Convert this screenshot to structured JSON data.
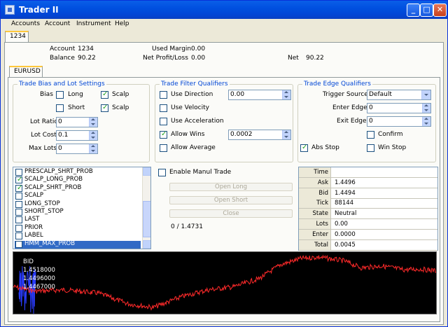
{
  "window": {
    "title": "Trader II"
  },
  "menu": [
    "Accounts",
    "Account",
    "Instrument",
    "Help"
  ],
  "tabs": {
    "account_tab": "1234",
    "instrument_tab": "EURUSD"
  },
  "summary": {
    "account_label": "Account",
    "account_value": "1234",
    "balance_label": "Balance",
    "balance_value": "90.22",
    "used_margin_label": "Used Margin",
    "used_margin_value": "0.00",
    "net_pl_label": "Net Profit/Loss",
    "net_pl_value": "0.00",
    "net_label": "Net",
    "net_value": "90.22"
  },
  "bias_group": {
    "title": "Trade Bias and Lot Settings",
    "bias_label": "Bias",
    "long_label": "Long",
    "long_checked": false,
    "short_label": "Short",
    "short_checked": false,
    "scalp1_label": "Scalp",
    "scalp1_checked": true,
    "scalp2_label": "Scalp",
    "scalp2_checked": true,
    "lot_ratio_label": "Lot Ratio",
    "lot_ratio_value": "0",
    "lot_cost_label": "Lot Cost",
    "lot_cost_value": "0.1",
    "max_lots_label": "Max Lots",
    "max_lots_value": "0"
  },
  "filter_group": {
    "title": "Trade Filter Qualifiers",
    "use_direction_label": "Use Direction",
    "use_direction_checked": false,
    "use_direction_value": "0.00",
    "use_velocity_label": "Use Velocity",
    "use_velocity_checked": false,
    "use_acceleration_label": "Use Acceleration",
    "use_acceleration_checked": false,
    "allow_wins_label": "Allow Wins",
    "allow_wins_checked": true,
    "allow_wins_value": "0.0002",
    "allow_average_label": "Allow Average",
    "allow_average_checked": false
  },
  "edge_group": {
    "title": "Trade Edge Qualifiers",
    "trigger_source_label": "Trigger Source",
    "trigger_source_value": "Default",
    "enter_edge_label": "Enter Edge",
    "enter_edge_value": "0",
    "exit_edge_label": "Exit Edge",
    "exit_edge_value": "0",
    "confirm_label": "Confirm",
    "confirm_checked": false,
    "abs_stop_label": "Abs Stop",
    "abs_stop_checked": true,
    "win_stop_label": "Win Stop",
    "win_stop_checked": false
  },
  "signal_list": [
    {
      "label": "PRESCALP_SHRT_PROB",
      "checked": false,
      "selected": false
    },
    {
      "label": "SCALP_LONG_PROB",
      "checked": true,
      "selected": false
    },
    {
      "label": "SCALP_SHRT_PROB",
      "checked": true,
      "selected": false
    },
    {
      "label": "SCALP",
      "checked": false,
      "selected": false
    },
    {
      "label": "LONG_STOP",
      "checked": false,
      "selected": false
    },
    {
      "label": "SHORT_STOP",
      "checked": false,
      "selected": false
    },
    {
      "label": "LAST",
      "checked": false,
      "selected": false
    },
    {
      "label": "PRIOR",
      "checked": false,
      "selected": false
    },
    {
      "label": "LABEL",
      "checked": false,
      "selected": false
    },
    {
      "label": "HMM_MAX_PROB",
      "checked": false,
      "selected": true
    }
  ],
  "manual": {
    "enable_label": "Enable Manul Trade",
    "enable_checked": false,
    "open_long_label": "Open Long",
    "open_short_label": "Open Short",
    "close_label": "Close",
    "status_text": "0 / 1.4731"
  },
  "quote_grid": [
    {
      "key": "Time",
      "value": ""
    },
    {
      "key": "Ask",
      "value": "1.4496"
    },
    {
      "key": "Bid",
      "value": "1.4494"
    },
    {
      "key": "Tick",
      "value": "88144"
    },
    {
      "key": "State",
      "value": "Neutral"
    },
    {
      "key": "Lots",
      "value": "0.00"
    },
    {
      "key": "Enter",
      "value": "0.0000"
    },
    {
      "key": "Total",
      "value": "0.0045"
    }
  ],
  "price_chart": {
    "labels": [
      "BID",
      "1.4518000",
      "1.4496000",
      "1.4467000"
    ],
    "line_color": "#ff2a2a",
    "overlay_color": "#2a3cff",
    "background": "#000000"
  },
  "colors": {
    "accent": "#0046d5",
    "titlebar": "#0050e0",
    "selection": "#316ac5",
    "tab_highlight": "#ffc83c"
  }
}
